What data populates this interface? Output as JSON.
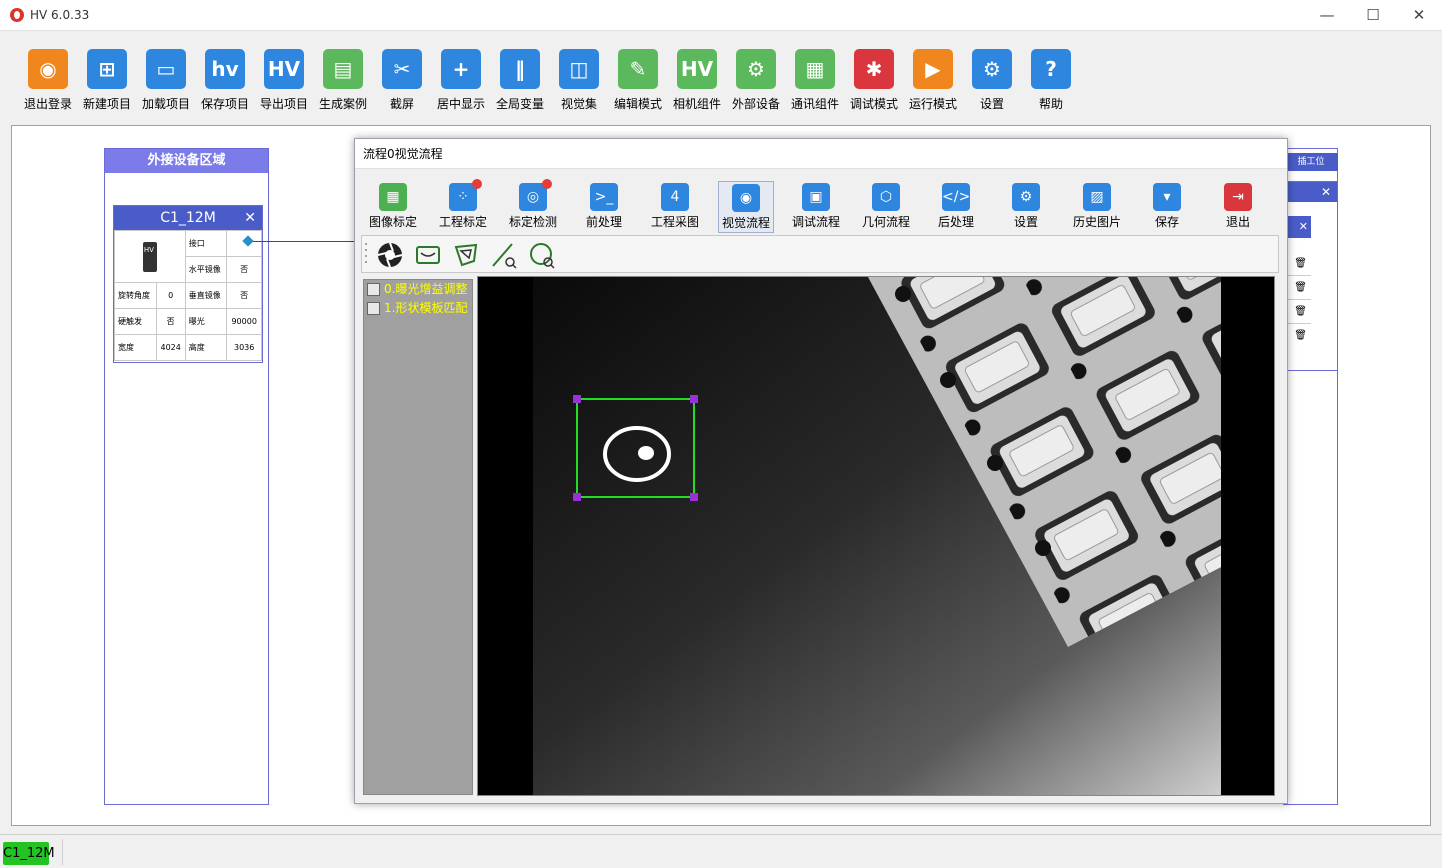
{
  "window": {
    "title": "HV 6.0.33",
    "minimize": "—",
    "maximize": "☐",
    "close": "✕"
  },
  "toolbar": [
    {
      "label": "退出登录",
      "icon": "user-logout-icon",
      "glyph": "◉",
      "color": "#f0861e"
    },
    {
      "label": "新建项目",
      "icon": "new-project-icon",
      "glyph": "⊞",
      "color": "#2e86de"
    },
    {
      "label": "加载项目",
      "icon": "load-project-icon",
      "glyph": "▭",
      "color": "#2e86de"
    },
    {
      "label": "保存项目",
      "icon": "save-project-icon",
      "glyph": "hv",
      "color": "#2e86de"
    },
    {
      "label": "导出项目",
      "icon": "export-project-icon",
      "glyph": "HV",
      "color": "#2e86de"
    },
    {
      "label": "生成案例",
      "icon": "generate-case-icon",
      "glyph": "▤",
      "color": "#5cb85c"
    },
    {
      "label": "截屏",
      "icon": "screenshot-scissors-icon",
      "glyph": "✂",
      "color": "#2e86de"
    },
    {
      "label": "居中显示",
      "icon": "center-display-icon",
      "glyph": "+",
      "color": "#2e86de"
    },
    {
      "label": "全局变量",
      "icon": "global-variable-icon",
      "glyph": "‖",
      "color": "#2e86de"
    },
    {
      "label": "视觉集",
      "icon": "vision-set-icon",
      "glyph": "◫",
      "color": "#2e86de"
    },
    {
      "label": "编辑模式",
      "icon": "edit-mode-icon",
      "glyph": "✎",
      "color": "#5cb85c"
    },
    {
      "label": "相机组件",
      "icon": "camera-component-icon",
      "glyph": "HV",
      "color": "#5cb85c"
    },
    {
      "label": "外部设备",
      "icon": "external-device-icon",
      "glyph": "⚙",
      "color": "#5cb85c"
    },
    {
      "label": "通讯组件",
      "icon": "communication-component-icon",
      "glyph": "▦",
      "color": "#5cb85c"
    },
    {
      "label": "调试模式",
      "icon": "debug-bug-icon",
      "glyph": "✱",
      "color": "#d9363e"
    },
    {
      "label": "运行模式",
      "icon": "run-mode-icon",
      "glyph": "▶",
      "color": "#f0861e"
    },
    {
      "label": "设置",
      "icon": "settings-gear-icon",
      "glyph": "⚙",
      "color": "#2e86de"
    },
    {
      "label": "帮助",
      "icon": "help-icon",
      "glyph": "?",
      "color": "#2e86de"
    }
  ],
  "ext_panel": {
    "title": "外接设备区域"
  },
  "device": {
    "name": "C1_12M",
    "close": "✕",
    "cam_label": "HV",
    "fields": {
      "interface_label": "接口",
      "hmirror_label": "水平镜像",
      "hmirror_value": "否",
      "rotation_label": "旋转角度",
      "rotation_value": "0",
      "vmirror_label": "垂直镜像",
      "vmirror_value": "否",
      "hwtrigger_label": "硬触发",
      "hwtrigger_value": "否",
      "exposure_label": "曝光",
      "exposure_value": "90000",
      "width_label": "宽度",
      "width_value": "4024",
      "height_label": "高度",
      "height_value": "3036"
    }
  },
  "right_panel": {
    "tag": "插工位",
    "close": "✕"
  },
  "vision_window": {
    "title": "流程0视觉流程",
    "buttons": [
      {
        "label": "图像标定",
        "icon": "image-calibration-grid-icon",
        "color": "#4caf50",
        "glyph": "▦",
        "dot": false,
        "active": false
      },
      {
        "label": "工程标定",
        "icon": "project-calibration-icon",
        "color": "#2e86de",
        "glyph": "⁘",
        "dot": true,
        "active": false
      },
      {
        "label": "标定检测",
        "icon": "calibration-check-icon",
        "color": "#2e86de",
        "glyph": "◎",
        "dot": true,
        "active": false
      },
      {
        "label": "前处理",
        "icon": "preprocess-terminal-icon",
        "color": "#2e86de",
        "glyph": ">_",
        "dot": false,
        "active": false
      },
      {
        "label": "工程采图",
        "icon": "project-capture-calendar-icon",
        "color": "#2e86de",
        "glyph": "4",
        "dot": false,
        "active": false
      },
      {
        "label": "视觉流程",
        "icon": "vision-flow-eye-icon",
        "color": "#2e86de",
        "glyph": "◉",
        "dot": false,
        "active": true
      },
      {
        "label": "调试流程",
        "icon": "debug-flow-icon",
        "color": "#2e86de",
        "glyph": "▣",
        "dot": false,
        "active": false
      },
      {
        "label": "几何流程",
        "icon": "geometry-flow-icon",
        "color": "#2e86de",
        "glyph": "⬡",
        "dot": false,
        "active": false
      },
      {
        "label": "后处理",
        "icon": "postprocess-code-icon",
        "color": "#2e86de",
        "glyph": "</>",
        "dot": false,
        "active": false
      },
      {
        "label": "设置",
        "icon": "settings-gear-icon",
        "color": "#2e86de",
        "glyph": "⚙",
        "dot": false,
        "active": false
      },
      {
        "label": "历史图片",
        "icon": "history-image-icon",
        "color": "#2e86de",
        "glyph": "▨",
        "dot": false,
        "active": false
      },
      {
        "label": "保存",
        "icon": "save-floppy-icon",
        "color": "#2e86de",
        "glyph": "▾",
        "dot": false,
        "active": false
      },
      {
        "label": "退出",
        "icon": "exit-door-icon",
        "color": "#d9363e",
        "glyph": "⇥",
        "dot": false,
        "active": false
      }
    ],
    "tools": [
      "aperture-icon",
      "rect-roi-icon",
      "polygon-roi-icon",
      "line-search-icon",
      "circle-search-icon"
    ],
    "steps": [
      {
        "label": "0.曝光增益调整",
        "icon": "exposure-step-icon"
      },
      {
        "label": "1.形状模板匹配",
        "icon": "template-step-icon"
      }
    ]
  },
  "status": {
    "camera": "C1_12M"
  }
}
